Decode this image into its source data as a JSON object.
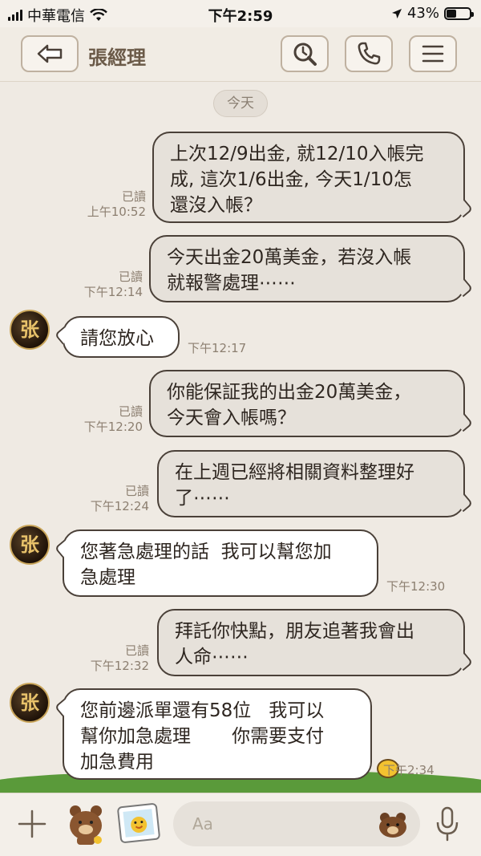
{
  "status_bar": {
    "carrier": "中華電信",
    "time": "下午2:59",
    "battery": "43%",
    "battery_level": 0.43
  },
  "header": {
    "title": "張經理"
  },
  "chat": {
    "date_label": "今天",
    "messages": [
      {
        "side": "out",
        "text": "上次12/9出金, 就12/10入帳完\n成, 這次1/6出金, 今天1/10怎\n還沒入帳？",
        "read": "已讀",
        "time": "上午10:52"
      },
      {
        "side": "out",
        "text": "今天出金20萬美金，若沒入帳\n就報警處理⋯⋯",
        "read": "已讀",
        "time": "下午12:14"
      },
      {
        "side": "in",
        "text": "請您放心",
        "time": "下午12:17"
      },
      {
        "side": "out",
        "text": "你能保証我的出金20萬美金，\n今天會入帳嗎？",
        "read": "已讀",
        "time": "下午12:20"
      },
      {
        "side": "out",
        "text": "在上週已經將相關資料整理好\n了⋯⋯",
        "read": "已讀",
        "time": "下午12:24"
      },
      {
        "side": "in",
        "text": "您著急處理的話  我可以幫您加\n急處理",
        "time": "下午12:30"
      },
      {
        "side": "out",
        "text": "拜託你快點，朋友追著我會出\n人命⋯⋯",
        "read": "已讀",
        "time": "下午12:32"
      },
      {
        "side": "in",
        "text": "您前邊派單還有58位   我可以\n幫你加急處理       你需要支付\n加急費用",
        "time": "下午2:34"
      }
    ],
    "avatar_char": "张"
  },
  "input_bar": {
    "placeholder": "Aa"
  },
  "colors": {
    "background": "#efeae3",
    "outgoing_bubble": "#e6e1da",
    "incoming_bubble": "#ffffff",
    "bubble_border": "#4a4038"
  },
  "icons": [
    "back-arrow-icon",
    "search-icon",
    "phone-icon",
    "menu-icon",
    "plus-icon",
    "bear-sticker-icon",
    "photo-sticker-icon",
    "emoji-icon",
    "microphone-icon"
  ]
}
